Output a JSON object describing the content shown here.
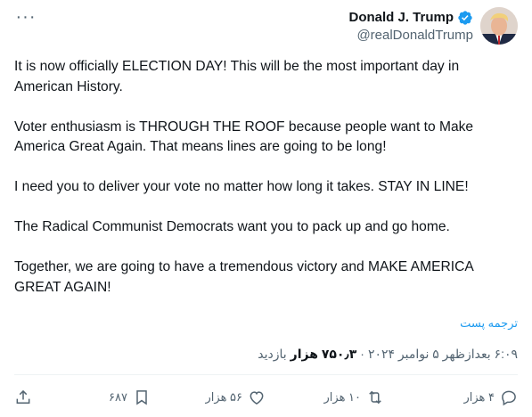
{
  "author": {
    "display_name": "Donald J. Trump",
    "handle": "@realDonaldTrump"
  },
  "tweet": {
    "paragraphs": [
      "It is now officially ELECTION DAY! This will be the most important day in American History.",
      "Voter enthusiasm is THROUGH THE ROOF because people want to Make America Great Again. That means lines are going to be long!",
      "I need you to deliver your vote no matter how long it takes. STAY IN LINE!",
      "The Radical Communist Democrats want you to pack up and go home.",
      "Together, we are going to have a tremendous victory and MAKE AMERICA GREAT AGAIN!"
    ]
  },
  "translate_label": "ترجمه پست",
  "meta": {
    "timestamp": "۶:۰۹ بعدازظهر ۵ نوامبر ۲۰۲۴",
    "separator": "·",
    "views_count": "۷۵۰٫۳ هزار",
    "views_label": "بازدید"
  },
  "actions": {
    "replies": "۴ هزار",
    "reposts": "۱۰ هزار",
    "likes": "۵۶ هزار",
    "bookmarks": "۶۸۷"
  },
  "colors": {
    "accent": "#1d9bf0",
    "text": "#0f1419",
    "secondary": "#536471"
  },
  "icons": [
    "more-horizontal-icon",
    "verified-badge-icon",
    "reply-icon",
    "repost-icon",
    "like-icon",
    "bookmark-icon",
    "share-icon"
  ]
}
